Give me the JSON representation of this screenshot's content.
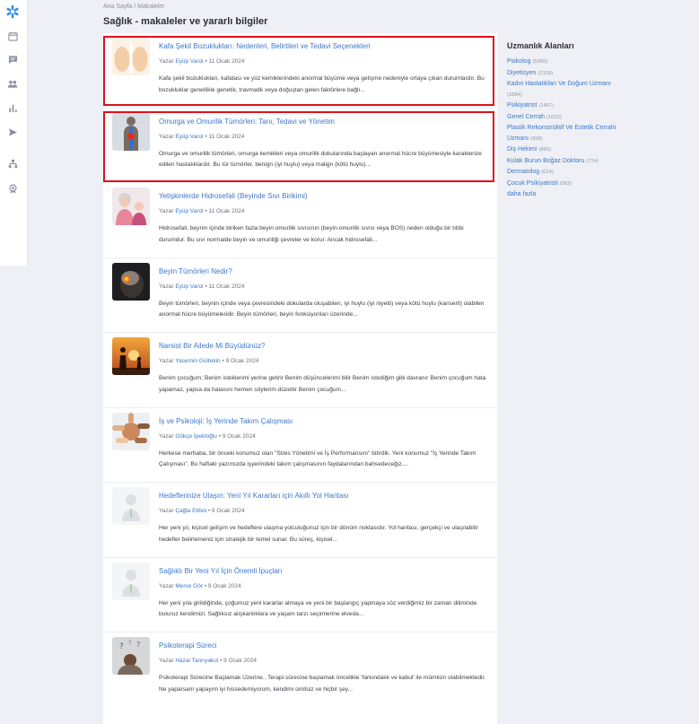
{
  "breadcrumb": {
    "home": "Ana Sayfa",
    "sep": "/",
    "current": "Makaleler"
  },
  "page_title": "Sağlık - makaleler ve yararlı bilgiler",
  "colors": {
    "accent": "#3c78c8",
    "highlight": "#e0101a",
    "background": "#eef0f5",
    "logo": "#2f8fe0"
  },
  "sidebar": {
    "items": [
      "calendar-icon",
      "chat-icon",
      "users-icon",
      "stats-icon",
      "send-icon",
      "hierarchy-icon",
      "award-icon"
    ]
  },
  "articles": [
    {
      "title": "Kafa Şekil Bozuklukları: Nedenleri, Belirtileri ve Tedavi Seçenekleri",
      "byline": "Yazar",
      "author": "Eyüp Varol",
      "date": "• 11 Ocak 2024",
      "excerpt": "Kafa şekil bozuklukları, kafatası ve yüz kemiklerindeki anormal büyüme veya gelişme nedeniyle ortaya çıkan durumlardır. Bu bozukluklar genellikle genetik, travmatik veya doğuştan gelen faktörlere bağlı..."
    },
    {
      "title": "Omurga ve Omurilik Tümörleri: Tanı, Tedavi ve Yönetim",
      "byline": "Yazar",
      "author": "Eyüp Varol",
      "date": "• 11 Ocak 2024",
      "excerpt": "Omurga ve omurilik tümörleri, omurga kemikleri veya omurilik dokularında başlayan anormal hücre büyümesiyle karakterize edilen hastalıklardır. Bu tür tümörler, benign (iyi huylu) veya malign (kötü huylu)..."
    },
    {
      "title": "Yetişkinlerde Hidrosefali (Beyinde Sıvı Birikimi)",
      "byline": "Yazar",
      "author": "Eyüp Varol",
      "date": "• 11 Ocak 2024",
      "excerpt": "Hidrosefali, beynin içinde biriken fazla beyin omurilik sıvısının (beyin-omurilik sıvısı veya BOS) neden olduğu bir tıbbi durumdur. Bu sıvı normalde beyin ve omuriliği çevreler ve korur. Ancak hidrosefali..."
    },
    {
      "title": "Beyin Tümörleri Nedir?",
      "byline": "Yazar",
      "author": "Eyüp Varol",
      "date": "• 11 Ocak 2024",
      "excerpt": "Beyin tümörleri, beynin içinde veya çevresindeki dokularda oluşabilen, iyi huylu (iyi niyetli) veya kötü huylu (kanserli) olabilen anormal hücre büyümeleridir. Beyin tümörleri, beyin fonksiyonları üzerinde..."
    },
    {
      "title": "Narsist Bir Ailede Mi Büyüdünüz?",
      "byline": "Yazar",
      "author": "Yasemin Gültekin",
      "date": "• 9 Ocak 2024",
      "excerpt": "Benim çocuğum; Benim isteklerimi yerine getirir Benim düşüncelerimi bilir Benim istediğim gibi davranır Benim çocuğum hata yapamaz, yapsa da hatasını hemen söylerim düzeltir Benim çocuğum..."
    },
    {
      "title": "İş ve Psikoloji: İş Yerinde Takım Çalışması",
      "byline": "Yazar",
      "author": "Gökçe İpekloğlu",
      "date": "• 9 Ocak 2024",
      "excerpt": "Herkese merhaba, bir önceki konumuz olan \"Stres Yönetimi ve İş Performansını\" bitirdik. Yeni konumuz \"İş Yerinde Takım Çalışması\". Bu haftaki yazımızda işyerindeki takım çalışmasının faydalarından bahsedeceğiz...."
    },
    {
      "title": "Hedeflerinize Ulaşın: Yeni Yıl Kararları için Akıllı Yol Haritası",
      "byline": "Yazar",
      "author": "Çağla Elibol",
      "date": "• 9 Ocak 2024",
      "excerpt": "Her yeni yıl, kişisel gelişim ve hedeflere ulaşma yolculuğunuz için bir dönüm noktasıdır. Yol haritası, gerçekçi ve ulaşılabilir hedefler belirlemeniz için stratejik bir temel sunar. Bu süreç, kişisel..."
    },
    {
      "title": "Sağlıklı Bir Yeni Yıl İçin Önemli İpuçları",
      "byline": "Yazar",
      "author": "Merve Gör",
      "date": "• 9 Ocak 2024",
      "excerpt": "Her yeni yıla girildiğinde, çoğumuz yeni kararlar almaya ve yeni bir başlangıç yapmaya söz verdiğimiz bir zaman diliminde buluruz kendimizi. Sağlıksız alışkanlıklara ve yaşam tarzı seçimlerine elveda..."
    },
    {
      "title": "Psikoterapi Süreci",
      "byline": "Yazar",
      "author": "Hazal Tanrıyakul",
      "date": "• 9 Ocak 2024",
      "excerpt": "Psikoterapi Sürecine Başlamak Üzerine.. Terapi sürecine başlamak öncelikle 'farkındalık ve kabul' ile mümkün olabilmektedir. Ne yaparsam yapayım iyi hissedemiyorum, kendimi ümitsiz ve hiçbir şey..."
    }
  ],
  "specialties": {
    "heading": "Uzmanlık Alanları",
    "items": [
      {
        "name": "Psikolog",
        "count": "(5260)"
      },
      {
        "name": "Diyetisyen",
        "count": "(2109)"
      },
      {
        "name": "Kadın Hastalıkları Ve Doğum Uzmanı",
        "count": "(1884)"
      },
      {
        "name": "Psikiyatrist",
        "count": "(1467)"
      },
      {
        "name": "Genel Cerrah",
        "count": "(1033)"
      },
      {
        "name": "Plastik Rekonstrüktif Ve Estetik Cerrahi Uzmanı",
        "count": "(958)"
      },
      {
        "name": "Diş Hekimi",
        "count": "(865)"
      },
      {
        "name": "Kulak Burun Boğaz Doktoru",
        "count": "(724)"
      },
      {
        "name": "Dermatolog",
        "count": "(614)"
      },
      {
        "name": "Çocuk Psikiyatristi",
        "count": "(562)"
      }
    ],
    "more": "daha fazla"
  }
}
